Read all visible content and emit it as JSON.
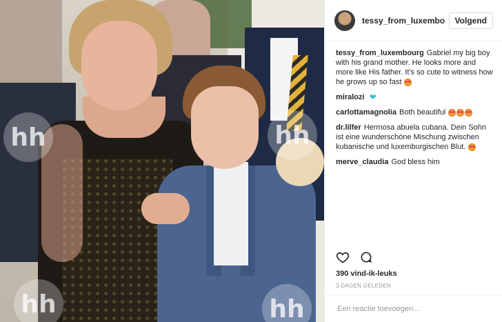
{
  "post": {
    "author": "tessy_from_luxembourg",
    "follow_label": "Volgend",
    "watermark_text": "hh",
    "caption": {
      "user": "tessy_from_luxembourg",
      "text": "Gabriel my big boy with his grand mother. He looks more and more like His father. It's so cute to witness how he grows up so fast"
    },
    "comments": [
      {
        "user": "miralozi",
        "text": "",
        "emoji": "blue-heart"
      },
      {
        "user": "carlottamagnolia",
        "text": "Both beautiful",
        "emoji": "heart-eyes x3"
      },
      {
        "user": "dr.lilfer",
        "text": "Hermosa abuela cubana. Dein Sohn ist eine wunderschöne Mischung zwischen kubanische und luxemburgischen Blut.",
        "emoji": "heart-eyes"
      },
      {
        "user": "merve_claudia",
        "text": "God bless him",
        "emoji": ""
      }
    ],
    "likes": "390 vind-ik-leuks",
    "timestamp": "3 DAGEN GELEDEN",
    "comment_placeholder": "Een reactie toevoegen..."
  },
  "icons": {
    "like": "heart-outline-icon",
    "comment": "comment-bubble-icon"
  }
}
